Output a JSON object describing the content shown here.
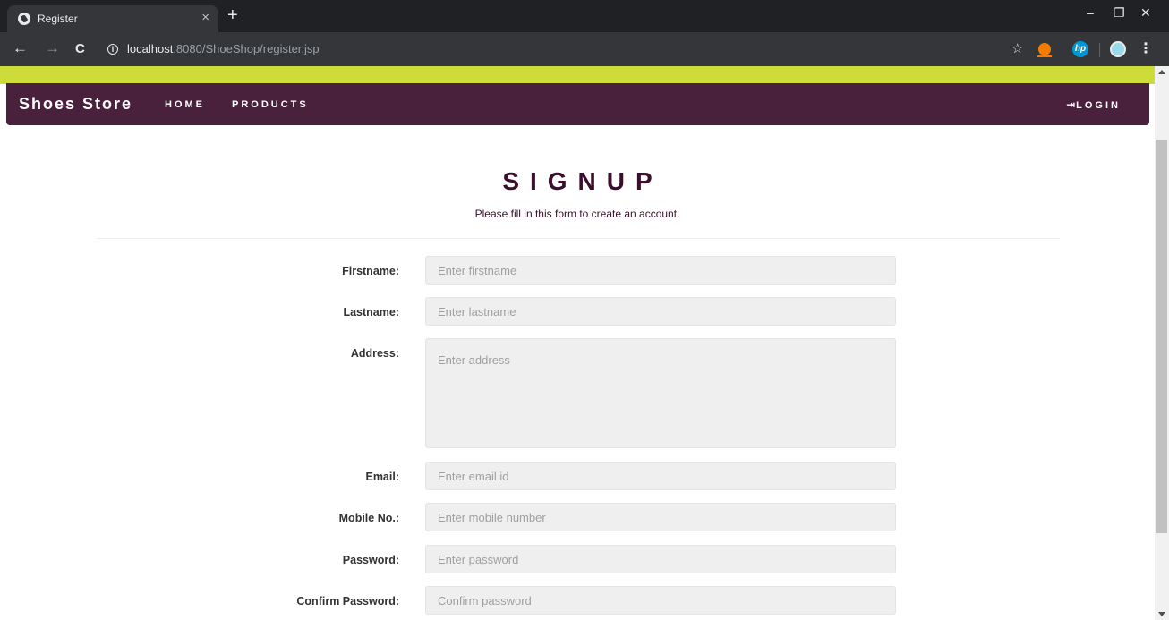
{
  "browser": {
    "tab_title": "Register",
    "tab_close": "×",
    "new_tab": "+",
    "url_host": "localhost",
    "url_rest": ":8080/ShoeShop/register.jsp",
    "ext_hp_label": "hp",
    "window_controls": {
      "minimize": "–",
      "restore": "❐",
      "close": "✕"
    }
  },
  "nav": {
    "brand": "Shoes Store",
    "links": [
      "HOME",
      "PRODUCTS"
    ],
    "login": "LOGIN"
  },
  "form": {
    "title": "SIGNUP",
    "subtitle": "Please fill in this form to create an account.",
    "fields": [
      {
        "label": "Firstname:",
        "placeholder": "Enter firstname",
        "value": ""
      },
      {
        "label": "Lastname:",
        "placeholder": "Enter lastname",
        "value": ""
      },
      {
        "label": "Address:",
        "placeholder": "Enter address",
        "value": ""
      },
      {
        "label": "Email:",
        "placeholder": "Enter email id",
        "value": ""
      },
      {
        "label": "Mobile No.:",
        "placeholder": "Enter mobile number",
        "value": ""
      },
      {
        "label": "Password:",
        "placeholder": "Enter password",
        "value": ""
      },
      {
        "label": "Confirm Password:",
        "placeholder": "Confirm password",
        "value": ""
      }
    ]
  },
  "colors": {
    "accent_strip": "#cddc39",
    "navbar": "#4a213d",
    "title": "#3b0f2c",
    "field_bg": "#efefef"
  }
}
